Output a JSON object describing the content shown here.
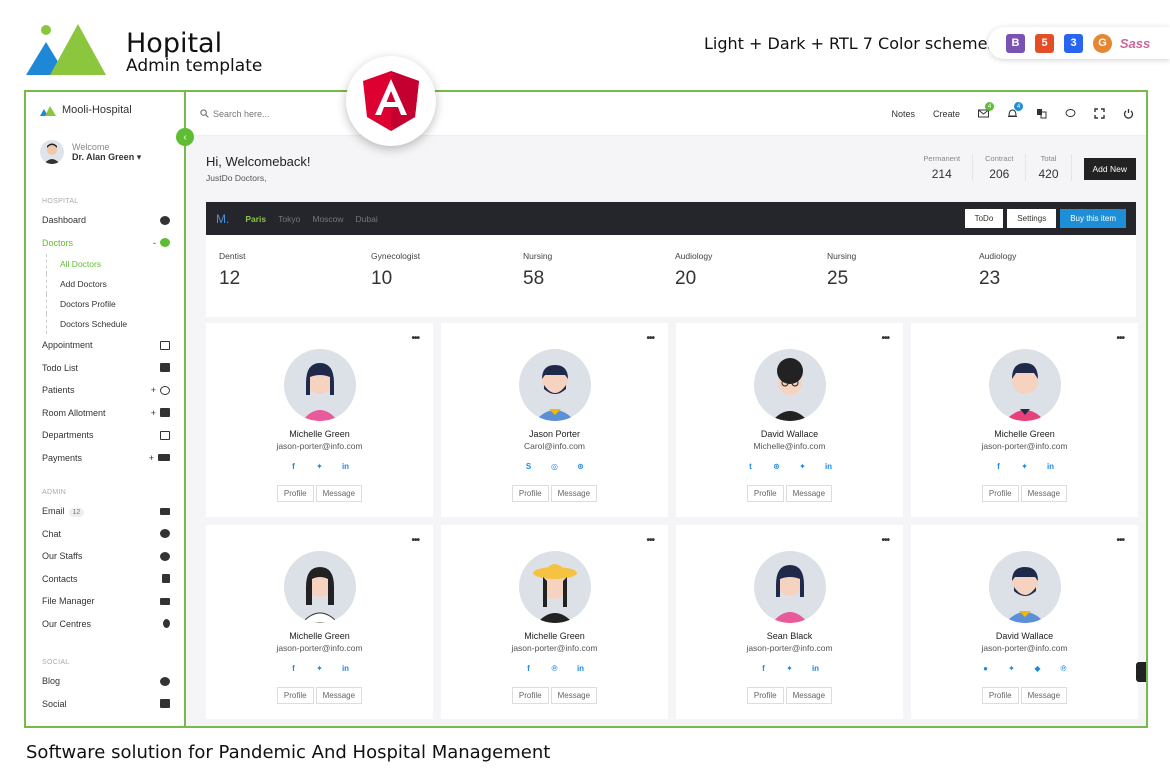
{
  "promo": {
    "title": "Hopital",
    "subtitle": "Admin template",
    "schemes": "Light + Dark + RTL 7 Color schemes",
    "tagline": "Software solution for Pandemic And Hospital Management",
    "tech_badges": [
      "bootstrap-icon",
      "html5-icon",
      "css3-icon",
      "grunt-icon",
      "sass-icon"
    ]
  },
  "sidebar": {
    "brand": "Mooli-Hospital",
    "welcome": "Welcome",
    "user": "Dr. Alan Green ▾",
    "sections": {
      "hospital": "HOSPITAL",
      "admin": "ADMIN",
      "social": "SOCIAL"
    },
    "items": {
      "dashboard": "Dashboard",
      "doctors": "Doctors",
      "doctors_sub": [
        "All Doctors",
        "Add Doctors",
        "Doctors Profile",
        "Doctors Schedule"
      ],
      "appointment": "Appointment",
      "todo": "Todo List",
      "patients": "Patients",
      "room": "Room Allotment",
      "departments": "Departments",
      "payments": "Payments",
      "email": "Email",
      "email_count": "12",
      "chat": "Chat",
      "staffs": "Our Staffs",
      "contacts": "Contacts",
      "files": "File Manager",
      "centres": "Our Centres",
      "blog": "Blog",
      "social": "Social"
    }
  },
  "topbar": {
    "search_placeholder": "Search here...",
    "notes": "Notes",
    "create": "Create",
    "mail_badge": "4",
    "bell_badge": "4",
    "accent": "#5fbd34",
    "bell_color": "#1e8fd6"
  },
  "header": {
    "greeting": "Hi, Welcomeback!",
    "subtitle": "JustDo Doctors,",
    "stats": [
      {
        "label": "Permanent",
        "value": "214"
      },
      {
        "label": "Contract",
        "value": "206"
      },
      {
        "label": "Total",
        "value": "420"
      }
    ],
    "add_new": "Add New"
  },
  "citybar": {
    "brand": "M.",
    "cities": [
      "Paris",
      "Tokyo",
      "Moscow",
      "Dubai"
    ],
    "todo": "ToDo",
    "settings": "Settings",
    "buy": "Buy this item"
  },
  "departments": [
    {
      "label": "Dentist",
      "value": "12"
    },
    {
      "label": "Gynecologist",
      "value": "10"
    },
    {
      "label": "Nursing",
      "value": "58"
    },
    {
      "label": "Audiology",
      "value": "20"
    },
    {
      "label": "Nursing",
      "value": "25"
    },
    {
      "label": "Audiology",
      "value": "23"
    }
  ],
  "cards": {
    "menu": "•••",
    "profile_label": "Profile",
    "message_label": "Message",
    "items": [
      {
        "name": "Michelle Green",
        "email": "jason-porter@info.com"
      },
      {
        "name": "Jason Porter",
        "email": "Carol@info.com"
      },
      {
        "name": "David Wallace",
        "email": "Michelle@info.com"
      },
      {
        "name": "Michelle Green",
        "email": "jason-porter@info.com"
      },
      {
        "name": "Michelle Green",
        "email": "jason-porter@info.com"
      },
      {
        "name": "Michelle Green",
        "email": "jason-porter@info.com"
      },
      {
        "name": "Sean Black",
        "email": "jason-porter@info.com"
      },
      {
        "name": "David Wallace",
        "email": "jason-porter@info.com"
      }
    ]
  }
}
